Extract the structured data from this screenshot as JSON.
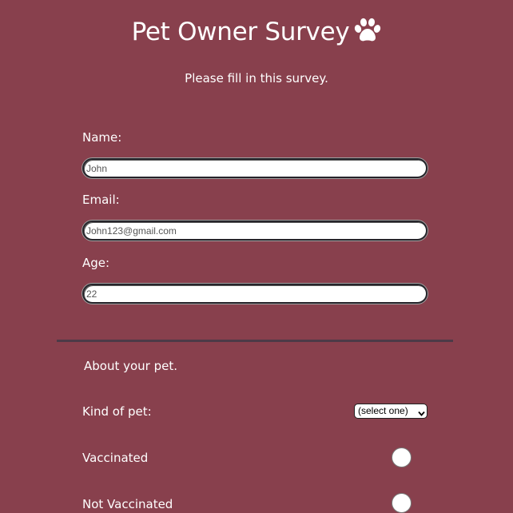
{
  "header": {
    "title": "Pet Owner Survey",
    "title_icon": "paw-icon",
    "description": "Please fill in this survey."
  },
  "form": {
    "name": {
      "label": "Name:",
      "value": "John"
    },
    "email": {
      "label": "Email:",
      "value": "John123@gmail.com"
    },
    "age": {
      "label": "Age:",
      "value": "22"
    }
  },
  "pet_section": {
    "heading": "About your pet.",
    "kind_label": "Kind of pet:",
    "kind_select_value": "(select one)",
    "vaccinated_label": "Vaccinated",
    "not_vaccinated_label": "Not Vaccinated"
  },
  "colors": {
    "background": "#88404d",
    "text": "#ffffff",
    "divider": "#4c3a47"
  }
}
